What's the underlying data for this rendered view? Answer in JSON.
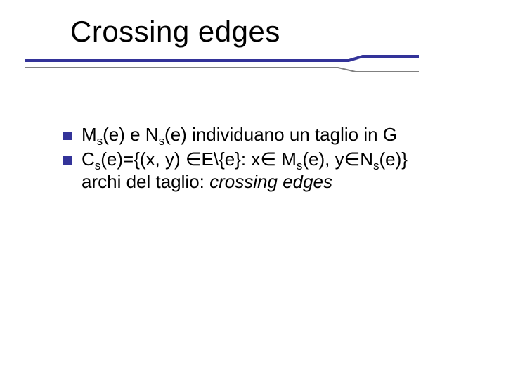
{
  "title": "Crossing edges",
  "bullets": [
    {
      "parts": [
        "M",
        "s",
        "(e) e N",
        "s",
        "(e) individuano un taglio in G"
      ]
    },
    {
      "line1": [
        "C",
        "s",
        "(e)={(x, y) ∈E\\{e}: x∈ M",
        "s",
        "(e), y∈N",
        "s",
        "(e)}"
      ],
      "line2_pre": "archi del taglio: ",
      "line2_em": "crossing edges"
    }
  ],
  "colors": {
    "accent": "#333399",
    "shadow": "#808080"
  }
}
